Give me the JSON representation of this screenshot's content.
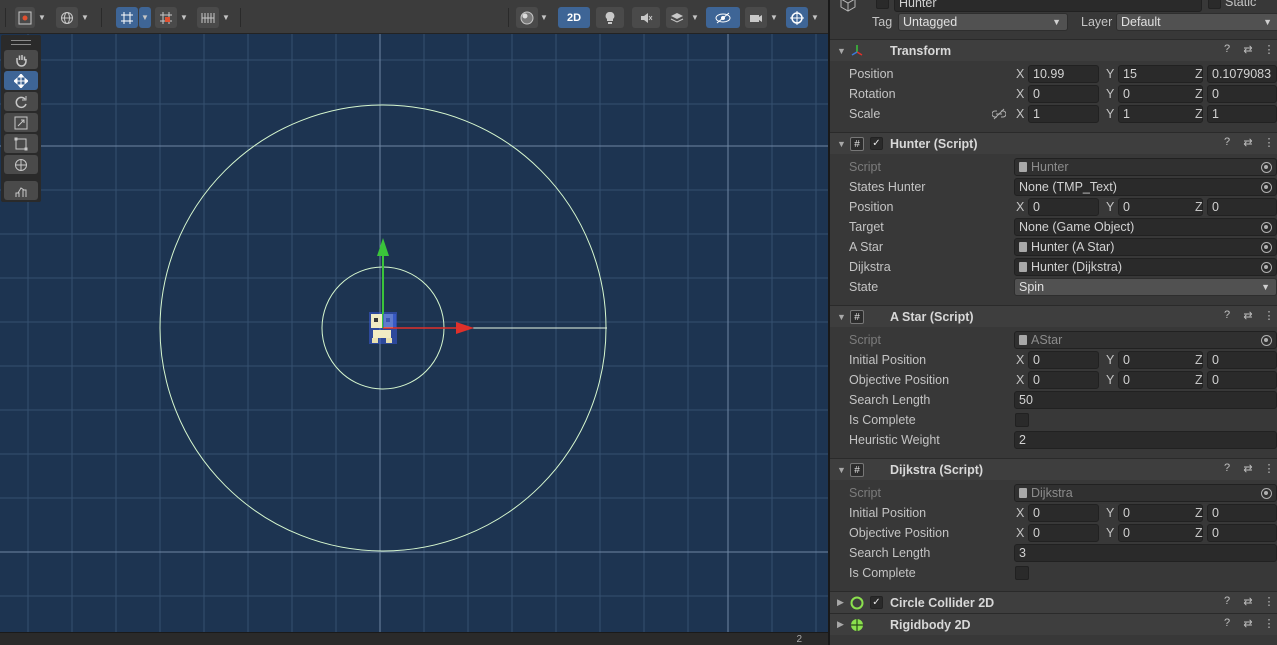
{
  "scene": {
    "view_mode": "2D",
    "bottom_text": "2"
  },
  "inspector": {
    "object_name": "Hunter",
    "static_label": "Static",
    "tag_label": "Tag",
    "tag_value": "Untagged",
    "layer_label": "Layer",
    "layer_value": "Default",
    "components": {
      "transform": {
        "title": "Transform",
        "position_label": "Position",
        "rotation_label": "Rotation",
        "scale_label": "Scale",
        "position": {
          "x": "10.99",
          "y": "15",
          "z": "0.1079083"
        },
        "rotation": {
          "x": "0",
          "y": "0",
          "z": "0"
        },
        "scale": {
          "x": "1",
          "y": "1",
          "z": "1"
        }
      },
      "hunter": {
        "title": "Hunter (Script)",
        "script_label": "Script",
        "script_value": "Hunter",
        "states_label": "States Hunter",
        "states_value": "None (TMP_Text)",
        "position_label": "Position",
        "position": {
          "x": "0",
          "y": "0",
          "z": "0"
        },
        "target_label": "Target",
        "target_value": "None (Game Object)",
        "astar_label": "A Star",
        "astar_value": "Hunter (A Star)",
        "dijkstra_label": "Dijkstra",
        "dijkstra_value": "Hunter (Dijkstra)",
        "state_label": "State",
        "state_value": "Spin"
      },
      "astar": {
        "title": "A Star (Script)",
        "script_label": "Script",
        "script_value": "AStar",
        "initial_label": "Initial Position",
        "initial": {
          "x": "0",
          "y": "0",
          "z": "0"
        },
        "objective_label": "Objective Position",
        "objective": {
          "x": "0",
          "y": "0",
          "z": "0"
        },
        "search_label": "Search Length",
        "search_value": "50",
        "complete_label": "Is Complete",
        "heuristic_label": "Heuristic Weight",
        "heuristic_value": "2"
      },
      "dijkstra": {
        "title": "Dijkstra (Script)",
        "script_label": "Script",
        "script_value": "Dijkstra",
        "initial_label": "Initial Position",
        "initial": {
          "x": "0",
          "y": "0",
          "z": "0"
        },
        "objective_label": "Objective Position",
        "objective": {
          "x": "0",
          "y": "0",
          "z": "0"
        },
        "search_label": "Search Length",
        "search_value": "3",
        "complete_label": "Is Complete"
      },
      "circle_collider": {
        "title": "Circle Collider 2D"
      },
      "rigidbody": {
        "title": "Rigidbody 2D"
      }
    },
    "axis": {
      "x": "X",
      "y": "Y",
      "z": "Z"
    }
  },
  "colors": {
    "scene_bg": "#1d3451",
    "panel_bg": "#383838",
    "accent": "#3e6596",
    "gizmo_x": "#e0302a",
    "gizmo_y": "#3ac43a"
  }
}
